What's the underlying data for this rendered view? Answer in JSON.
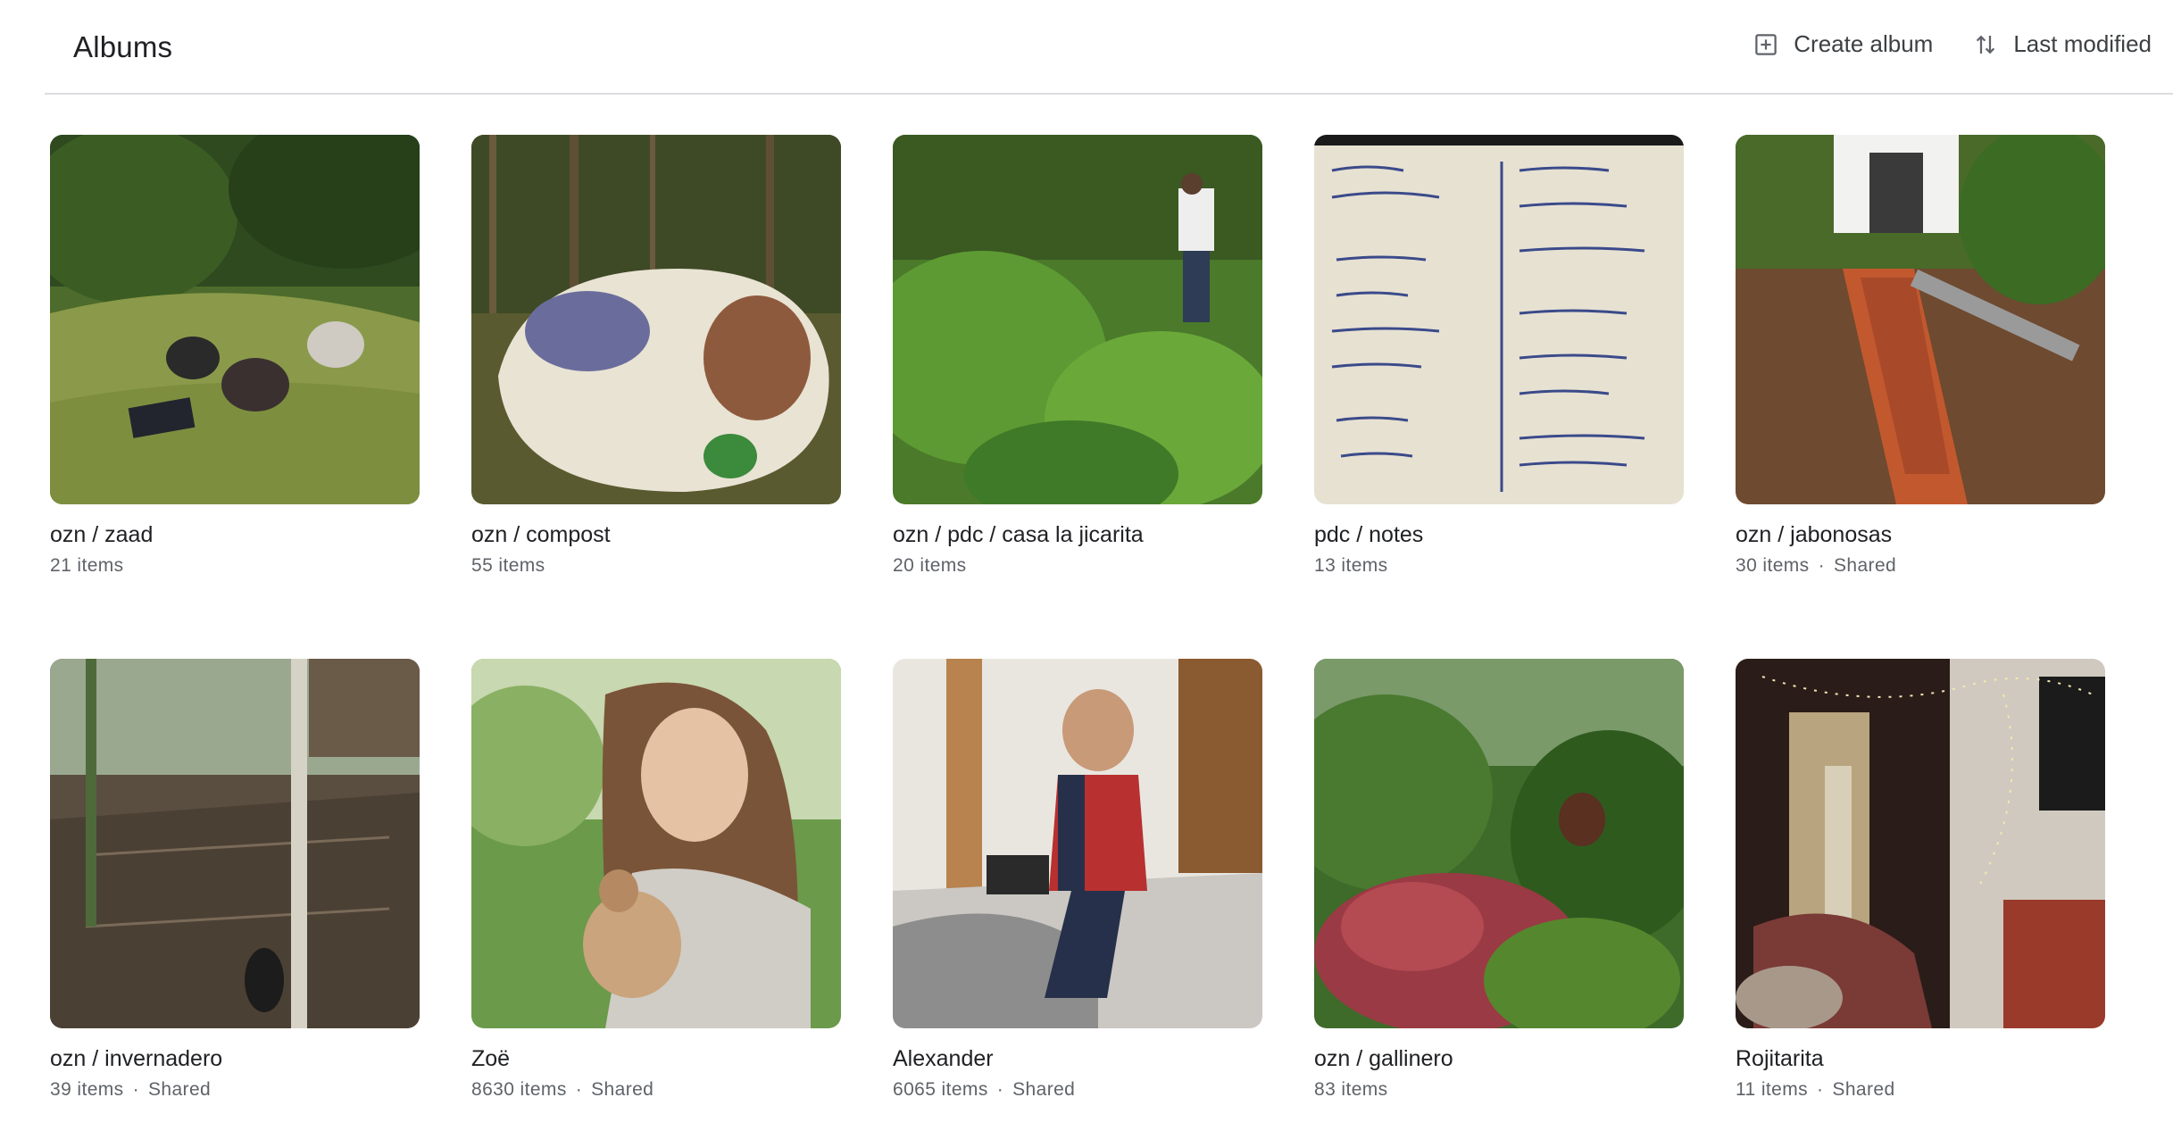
{
  "header": {
    "title": "Albums",
    "create_label": "Create album",
    "sort_label": "Last modified"
  },
  "icons": {
    "create": "add-box-icon",
    "sort": "sort-arrows-icon"
  },
  "albums": [
    {
      "title": "ozn / zaad",
      "count": "21 items",
      "shared": "",
      "thumb_desc": "garden with potted plants"
    },
    {
      "title": "ozn / compost",
      "count": "55 items",
      "shared": "",
      "thumb_desc": "compost sack in forest"
    },
    {
      "title": "ozn / pdc / casa la jicarita",
      "count": "20 items",
      "shared": "",
      "thumb_desc": "vegetable garden with gardener"
    },
    {
      "title": "pdc / notes",
      "count": "13 items",
      "shared": "",
      "thumb_desc": "handwritten notes on paper"
    },
    {
      "title": "ozn / jabonosas",
      "count": "30 items",
      "shared": "Shared",
      "thumb_desc": "brick channel construction"
    },
    {
      "title": "ozn / invernadero",
      "count": "39 items",
      "shared": "Shared",
      "thumb_desc": "garden beds with dog"
    },
    {
      "title": "Zoë",
      "count": "8630 items",
      "shared": "Shared",
      "thumb_desc": "girl holding puppy"
    },
    {
      "title": "Alexander",
      "count": "6065 items",
      "shared": "Shared",
      "thumb_desc": "boy with tablet on bed"
    },
    {
      "title": "ozn / gallinero",
      "count": "83 items",
      "shared": "",
      "thumb_desc": "lush garden with chicken"
    },
    {
      "title": "Rojitarita",
      "count": "11 items",
      "shared": "Shared",
      "thumb_desc": "room with string lights"
    }
  ]
}
